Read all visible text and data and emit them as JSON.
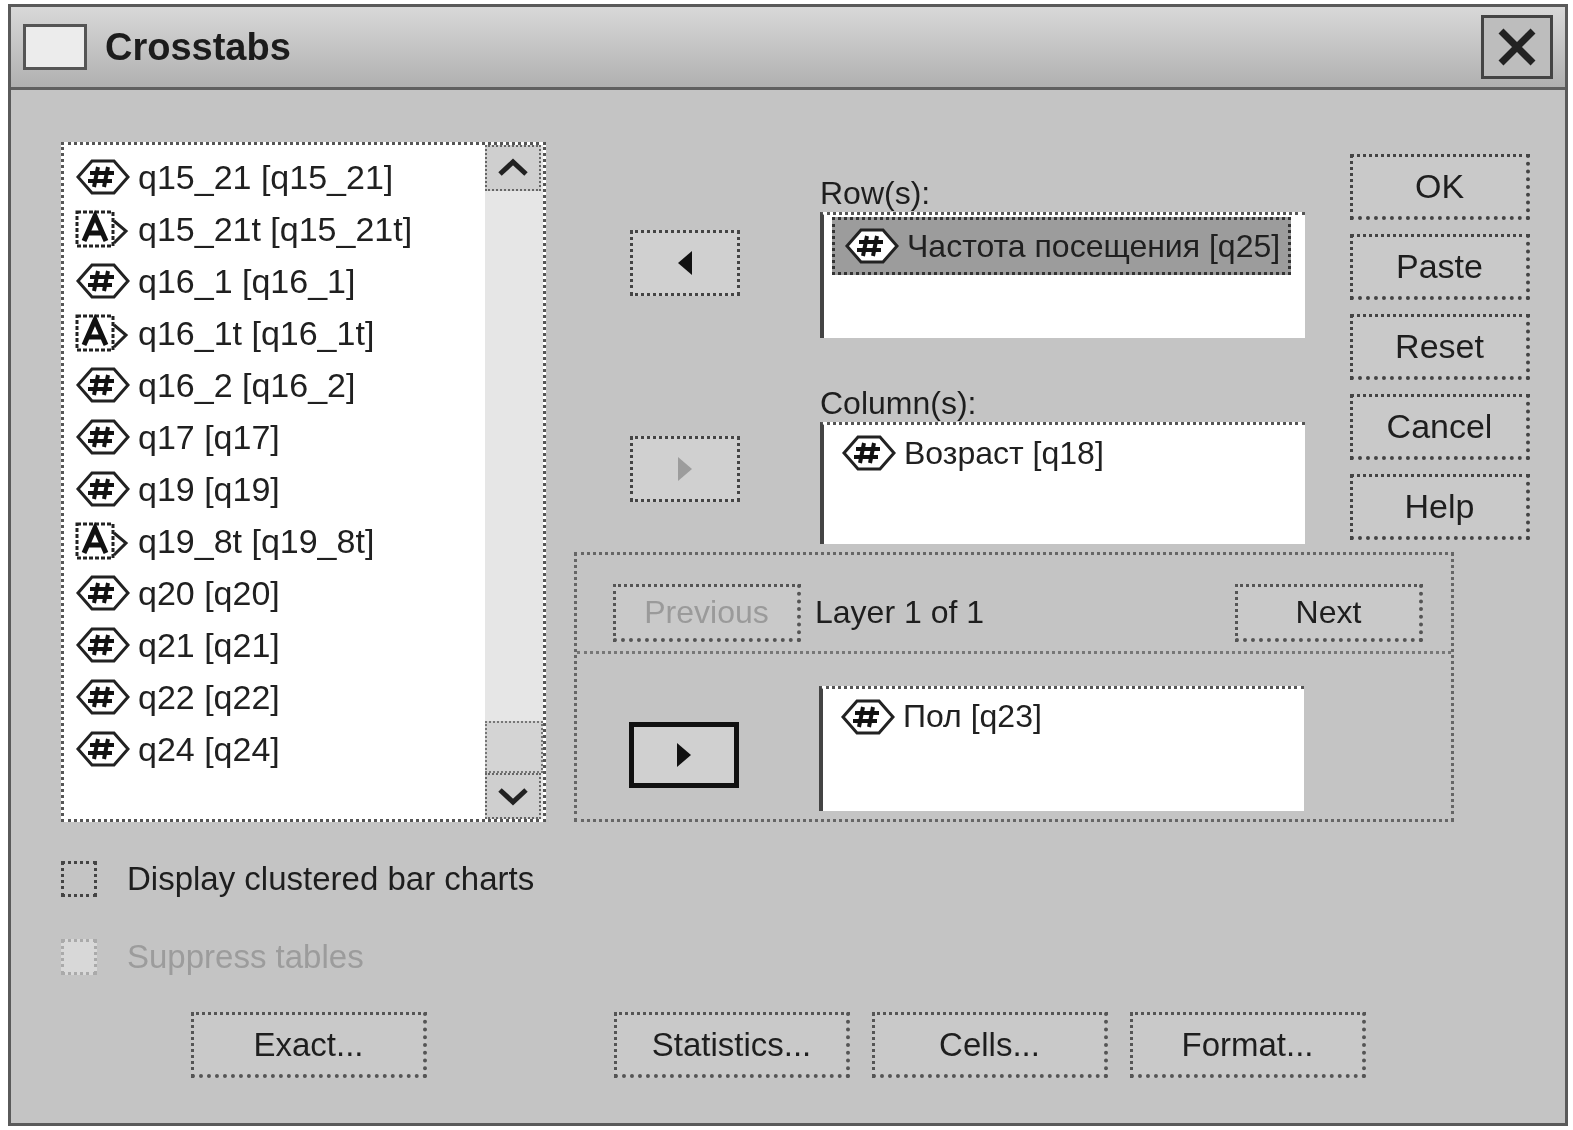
{
  "window": {
    "title": "Crosstabs"
  },
  "variables": [
    {
      "label": "q15_21 [q15_21]",
      "kind": "numeric"
    },
    {
      "label": "q15_21t [q15_21t]",
      "kind": "string"
    },
    {
      "label": "q16_1 [q16_1]",
      "kind": "numeric"
    },
    {
      "label": "q16_1t [q16_1t]",
      "kind": "string"
    },
    {
      "label": "q16_2 [q16_2]",
      "kind": "numeric"
    },
    {
      "label": "q17 [q17]",
      "kind": "numeric"
    },
    {
      "label": "q19 [q19]",
      "kind": "numeric"
    },
    {
      "label": "q19_8t [q19_8t]",
      "kind": "string"
    },
    {
      "label": "q20 [q20]",
      "kind": "numeric"
    },
    {
      "label": "q21 [q21]",
      "kind": "numeric"
    },
    {
      "label": "q22 [q22]",
      "kind": "numeric"
    },
    {
      "label": "q24 [q24]",
      "kind": "numeric"
    }
  ],
  "rows": {
    "label": "Row(s):",
    "move_button": {
      "kind": "left",
      "disabled": false,
      "focused": false
    },
    "items": [
      {
        "label": "Частота посещения [q25]",
        "kind": "numeric",
        "selected": true
      }
    ]
  },
  "columns": {
    "label": "Column(s):",
    "move_button": {
      "kind": "right",
      "disabled": true,
      "focused": false
    },
    "items": [
      {
        "label": "Возраст [q18]",
        "kind": "numeric",
        "selected": false
      }
    ]
  },
  "actions": [
    {
      "label": "OK"
    },
    {
      "label": "Paste"
    },
    {
      "label": "Reset"
    },
    {
      "label": "Cancel"
    },
    {
      "label": "Help"
    }
  ],
  "layer": {
    "previous": {
      "label": "Previous",
      "disabled": true
    },
    "caption": "Layer 1 of 1",
    "next": {
      "label": "Next",
      "disabled": false
    },
    "move_button": {
      "kind": "right",
      "disabled": false,
      "focused": true
    },
    "items": [
      {
        "label": "Пол [q23]",
        "kind": "numeric",
        "selected": false
      }
    ]
  },
  "options": [
    {
      "label": "Display clustered bar charts",
      "checked": false,
      "disabled": false
    },
    {
      "label": "Suppress tables",
      "checked": false,
      "disabled": true
    }
  ],
  "footer_buttons": [
    {
      "label": "Exact..."
    },
    {
      "label": "Statistics..."
    },
    {
      "label": "Cells..."
    },
    {
      "label": "Format..."
    }
  ]
}
